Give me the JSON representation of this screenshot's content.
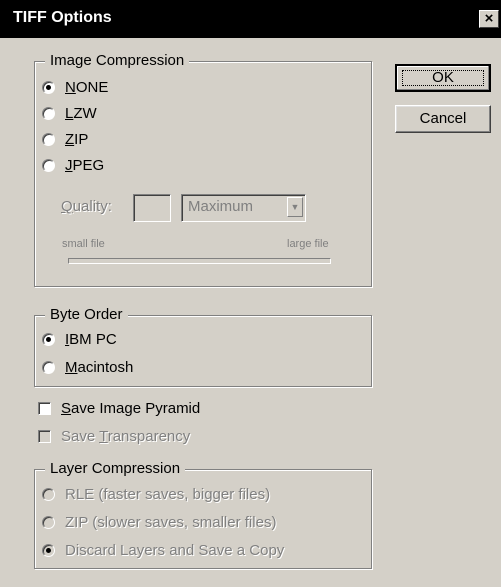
{
  "window": {
    "title": "TIFF Options",
    "close_glyph": "×"
  },
  "buttons": {
    "ok": "OK",
    "cancel": "Cancel"
  },
  "image_compression": {
    "legend": "Image Compression",
    "options": [
      {
        "mnemonic": "N",
        "rest": "ONE",
        "checked": true
      },
      {
        "mnemonic": "L",
        "rest": "ZW",
        "checked": false
      },
      {
        "mnemonic": "Z",
        "rest": "IP",
        "checked": false
      },
      {
        "mnemonic": "J",
        "rest": "PEG",
        "checked": false
      }
    ],
    "quality_label_mnemonic": "Q",
    "quality_label_rest": "uality:",
    "quality_value": "",
    "quality_select": "Maximum",
    "small_file": "small file",
    "large_file": "large file"
  },
  "byte_order": {
    "legend": "Byte Order",
    "options": [
      {
        "mnemonic": "I",
        "rest": "BM PC",
        "checked": true
      },
      {
        "mnemonic": "M",
        "rest": "acintosh",
        "checked": false
      }
    ]
  },
  "checkboxes": {
    "pyramid": {
      "mnemonic": "S",
      "rest": "ave Image Pyramid",
      "checked": false,
      "enabled": true
    },
    "transparency": {
      "prefix": "Save ",
      "mnemonic": "T",
      "rest": "ransparency",
      "checked": false,
      "enabled": false
    }
  },
  "layer_compression": {
    "legend": "Layer Compression",
    "options": [
      "RLE (faster saves, bigger files)",
      "ZIP (slower saves, smaller files)",
      "Discard Layers and Save a Copy"
    ]
  },
  "icons": {
    "close": "close-icon",
    "dropdown": "chevron-down-icon"
  }
}
